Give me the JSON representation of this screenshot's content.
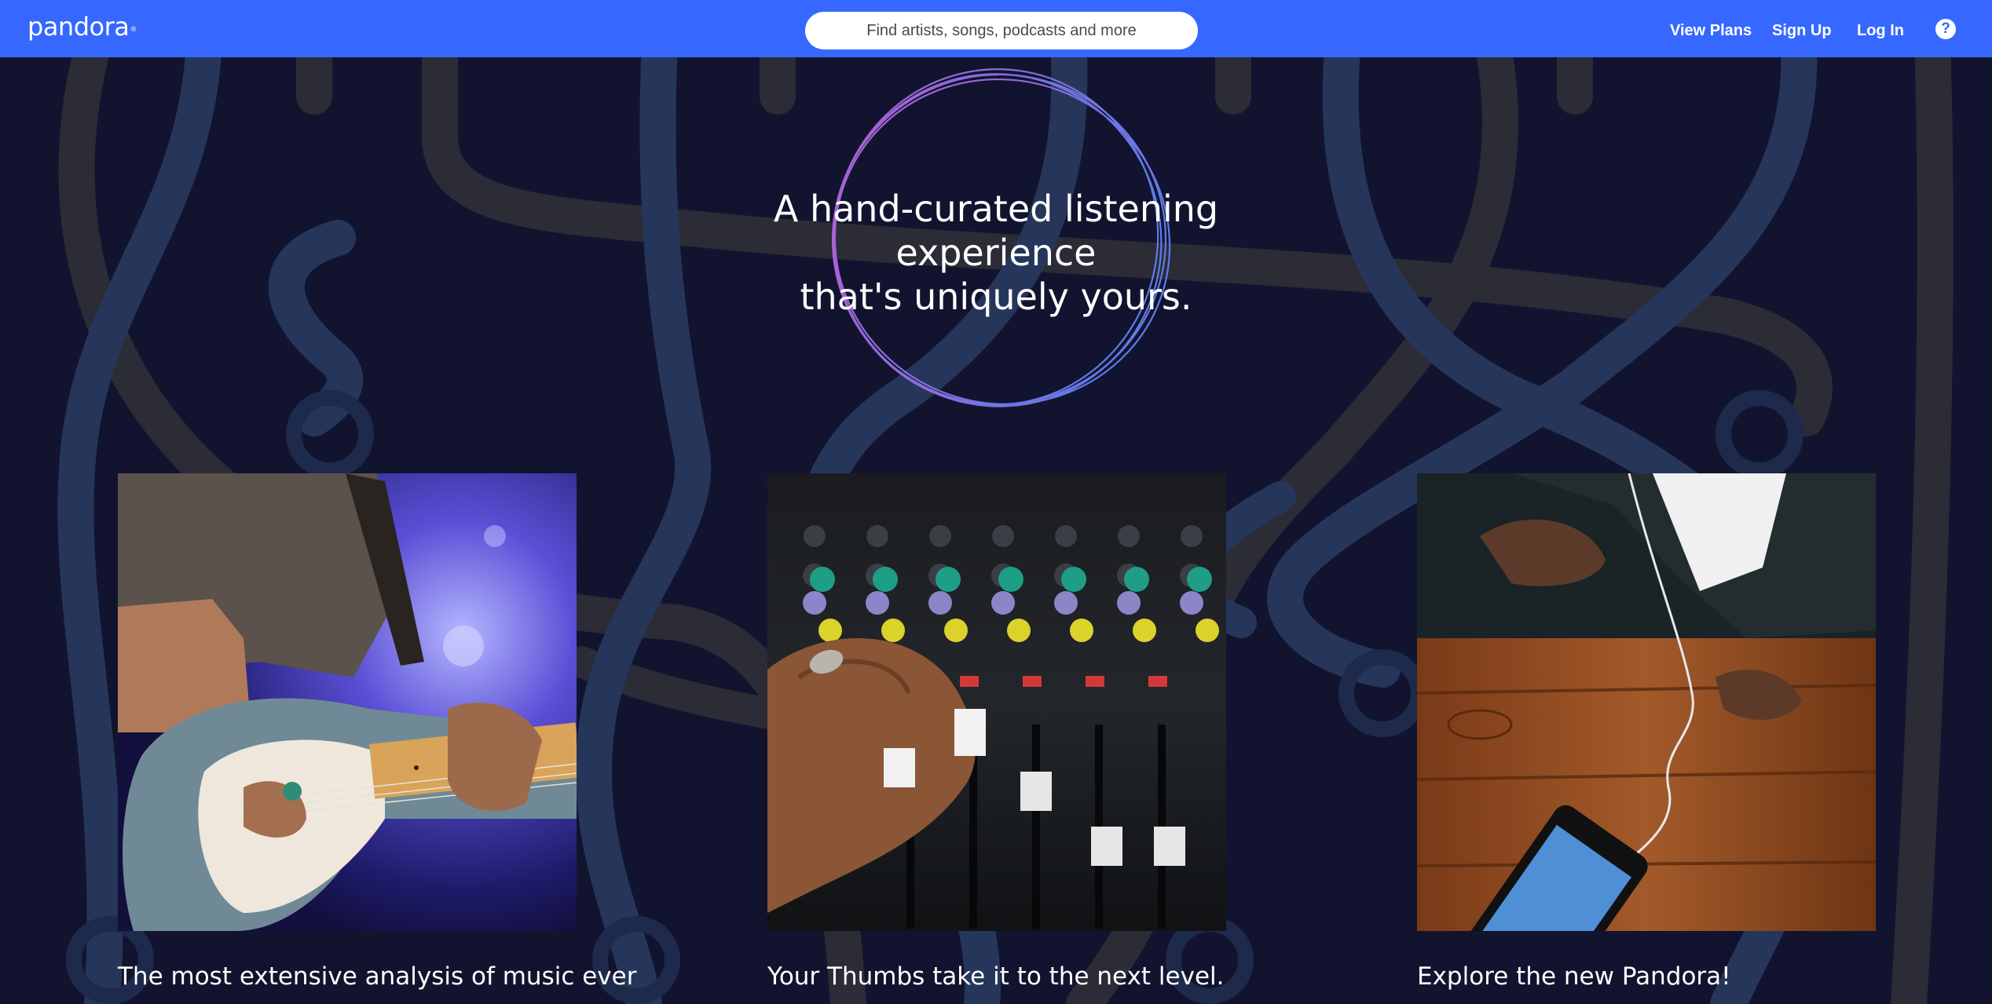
{
  "brand": {
    "logo_text": "pandora",
    "logo_mark": "®"
  },
  "header": {
    "search_placeholder": "Find artists, songs, podcasts and more",
    "nav": {
      "view_plans": "View Plans",
      "sign_up": "Sign Up",
      "log_in": "Log In"
    },
    "help_icon_glyph": "?"
  },
  "hero": {
    "title_line1": "A hand-curated listening experience",
    "title_line2": "that's uniquely yours."
  },
  "features": [
    {
      "image": "guitarist-photo",
      "caption": "The most extensive analysis of music ever"
    },
    {
      "image": "mixing-board-photo",
      "caption": "Your Thumbs take it to the next level."
    },
    {
      "image": "phone-earbuds-photo",
      "caption": "Explore the new Pandora!"
    }
  ],
  "colors": {
    "header_bg": "#3668ff",
    "page_bg": "#12142f",
    "cable_blue": "#26365a",
    "cable_gray": "#2b2c36",
    "circle_gradient_start": "#b15fd1",
    "circle_gradient_end": "#5f7be8"
  }
}
